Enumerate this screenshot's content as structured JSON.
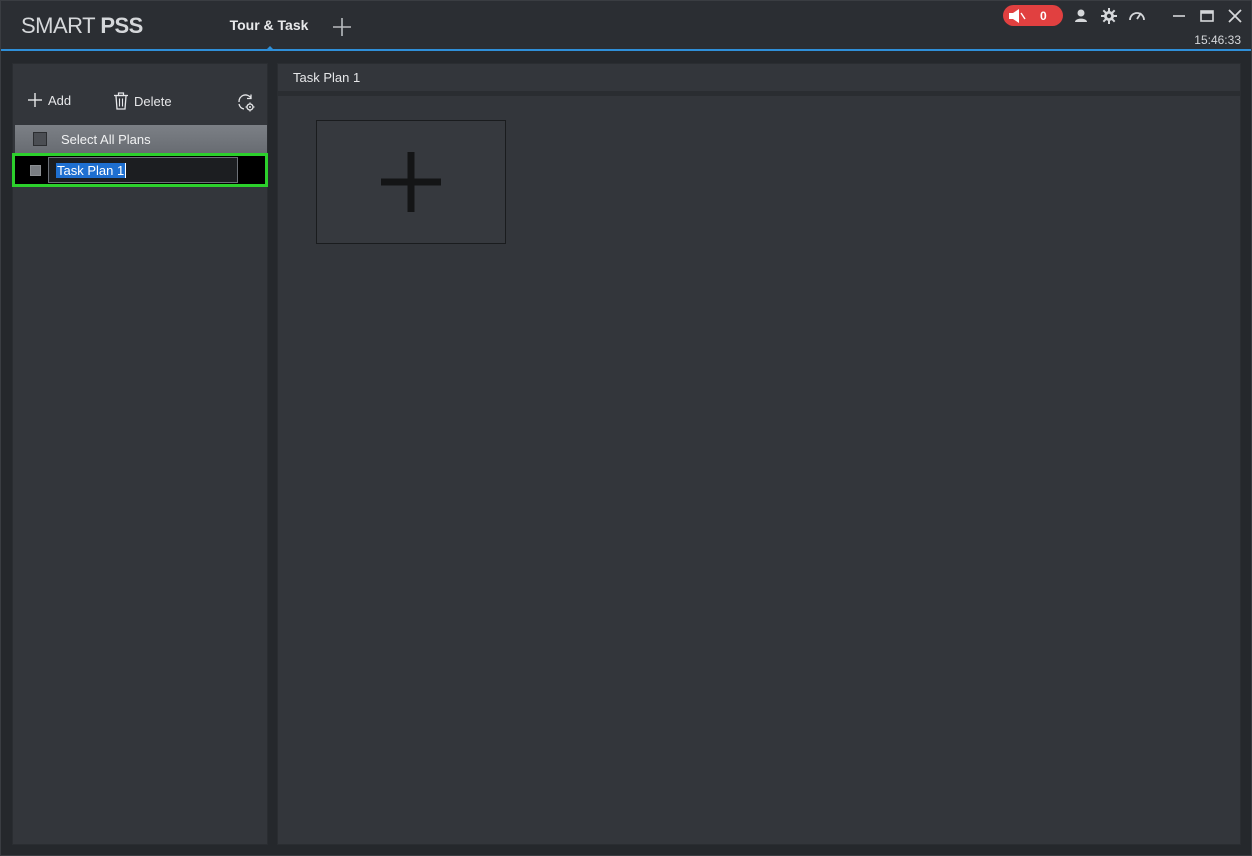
{
  "app": {
    "logo_light": "SMART ",
    "logo_bold": "PSS",
    "active_tab": "Tour & Task",
    "alarm_count": "0",
    "clock": "15:46:33",
    "accent_color": "#2f8fd8",
    "alarm_color": "#e14040"
  },
  "icons": {
    "tab_add": "plus-icon",
    "alarm": "speaker-mute-icon",
    "user": "user-icon",
    "settings": "gear-icon",
    "performance": "speedometer-icon",
    "minimize": "minimize-icon",
    "maximize": "maximize-icon",
    "close": "close-icon",
    "refresh": "refresh-settings-icon"
  },
  "left_panel": {
    "add_label": "Add",
    "delete_label": "Delete",
    "select_all_label": "Select All Plans",
    "plans": [
      {
        "name": "Task Plan 1",
        "editing": true
      }
    ]
  },
  "right_panel": {
    "title": "Task Plan 1"
  }
}
